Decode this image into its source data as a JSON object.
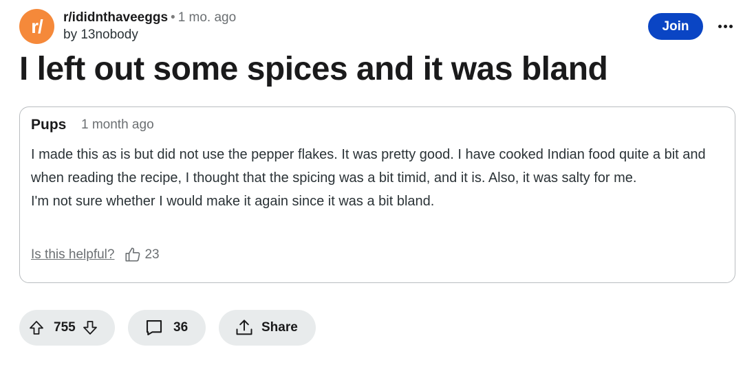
{
  "post": {
    "subreddit_icon_text": "r/",
    "subreddit": "r/ididnthaveeggs",
    "separator": "•",
    "time": "1 mo. ago",
    "author": "by 13nobody",
    "join_label": "Join",
    "title": "I left out some spices and it was bland"
  },
  "comment": {
    "author": "Pups",
    "time": "1 month ago",
    "body_line_1": "I made this as is but did not use the pepper flakes. It was pretty good. I have cooked Indian food quite a bit and when reading the recipe, I thought that the spicing was a bit timid, and it is. Also, it was salty for me.",
    "body_line_2": "I'm not sure whether I would make it again since it was a bit bland.",
    "helpful_label": "Is this helpful?",
    "helpful_count": "23"
  },
  "actions": {
    "vote_count": "755",
    "comment_count": "36",
    "share_label": "Share"
  },
  "icons": {
    "subreddit": "subreddit-avatar-icon",
    "more": "more-options-icon",
    "thumb": "thumbs-up-icon",
    "upvote": "upvote-arrow-icon",
    "downvote": "downvote-arrow-icon",
    "comment": "comment-bubble-icon",
    "share": "share-icon"
  },
  "colors": {
    "subreddit_icon": "#f5893a",
    "join_button": "#0a45c4",
    "pill_background": "#e8ebec"
  }
}
